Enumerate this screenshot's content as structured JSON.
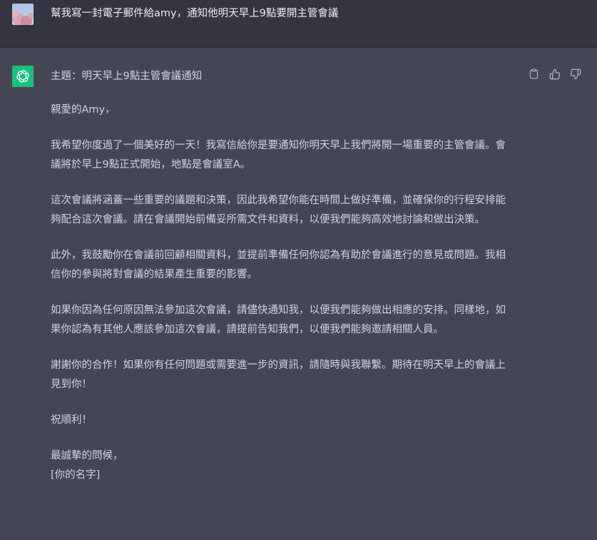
{
  "user_message": {
    "text": "幫我寫一封電子郵件給amy，通知他明天早上9點要開主管會議"
  },
  "assistant_message": {
    "subject": "主題：明天早上9點主管會議通知",
    "greeting": "親愛的Amy，",
    "paragraphs": [
      "我希望你度過了一個美好的一天！我寫信給你是要通知你明天早上我們將開一場重要的主管會議。會議將於早上9點正式開始，地點是會議室A。",
      "這次會議將涵蓋一些重要的議題和決策，因此我希望你能在時間上做好準備，並確保你的行程安排能夠配合這次會議。請在會議開始前備妥所需文件和資料，以便我們能夠高效地討論和做出決策。",
      "此外，我鼓勵你在會議前回顧相關資料，並提前準備任何你認為有助於會議進行的意見或問題。我相信你的參與將對會議的結果產生重要的影響。",
      "如果你因為任何原因無法參加這次會議，請儘快通知我，以便我們能夠做出相應的安排。同樣地，如果你認為有其他人應該參加這次會議，請提前告知我們，以便我們能夠邀請相關人員。",
      "謝謝你的合作！如果你有任何問題或需要進一步的資訊，請隨時與我聯繫。期待在明天早上的會議上見到你！"
    ],
    "closing": "祝順利！",
    "signoff": "最誠摯的問候，",
    "signature": "[你的名字]"
  },
  "actions": {
    "copy_icon": "clipboard-icon",
    "like_icon": "thumbs-up-icon",
    "dislike_icon": "thumbs-down-icon"
  },
  "colors": {
    "user_bg": "#343541",
    "assistant_bg": "#444654",
    "gpt_avatar": "#19c37d",
    "text": "#d1d5db",
    "icon": "#acacbe"
  }
}
